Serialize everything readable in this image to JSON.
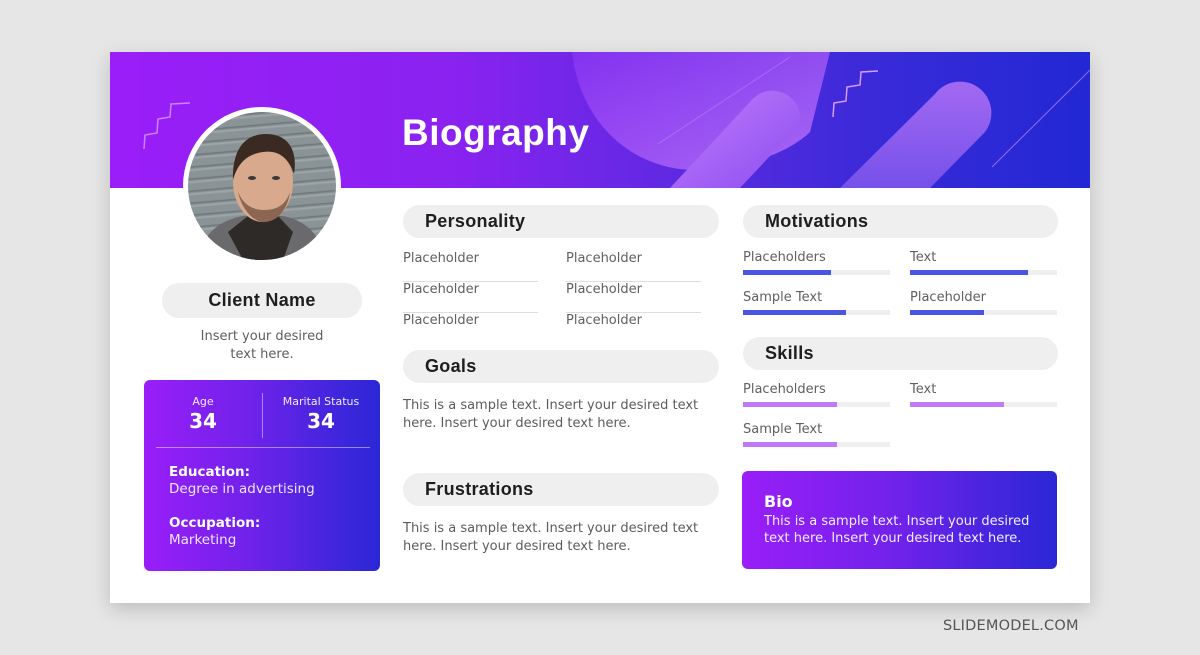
{
  "banner": {
    "title": "Biography"
  },
  "profile": {
    "name": "Client Name",
    "description_line1": "Insert your desired",
    "description_line2": "text here."
  },
  "info_card": {
    "age": {
      "label": "Age",
      "value": "34"
    },
    "marital_status": {
      "label": "Marital Status",
      "value": "34"
    },
    "education": {
      "label": "Education:",
      "value": "Degree in advertising"
    },
    "occupation": {
      "label": "Occupation:",
      "value": "Marketing"
    }
  },
  "personality": {
    "title": "Personality",
    "items": [
      "Placeholder",
      "Placeholder",
      "Placeholder",
      "Placeholder",
      "Placeholder",
      "Placeholder"
    ]
  },
  "goals": {
    "title": "Goals",
    "line1": "This is a sample text. Insert your desired text",
    "line2": "here. Insert your desired text here."
  },
  "frustrations": {
    "title": "Frustrations",
    "line1": "This is a sample text. Insert your desired text",
    "line2": "here. Insert your desired text here."
  },
  "motivations": {
    "title": "Motivations",
    "color": "#4a55e4",
    "items": [
      {
        "label": "Placeholders",
        "level": 0.6
      },
      {
        "label": "Text",
        "level": 0.8
      },
      {
        "label": "Sample Text",
        "level": 0.7
      },
      {
        "label": "Placeholder",
        "level": 0.5
      }
    ]
  },
  "skills": {
    "title": "Skills",
    "color": "#c07af5",
    "items": [
      {
        "label": "Placeholders",
        "level": 0.64
      },
      {
        "label": "Text",
        "level": 0.64
      },
      {
        "label": "Sample Text",
        "level": 0.64
      }
    ]
  },
  "bio": {
    "title": "Bio",
    "line1": "This is a sample text. Insert your desired",
    "line2": "text here. Insert your desired text here."
  },
  "watermark": "SLIDEMODEL.COM",
  "colors": {
    "gradient_start": "#9a1ef8",
    "gradient_end": "#2228d4",
    "pill_bg": "#efefef"
  }
}
